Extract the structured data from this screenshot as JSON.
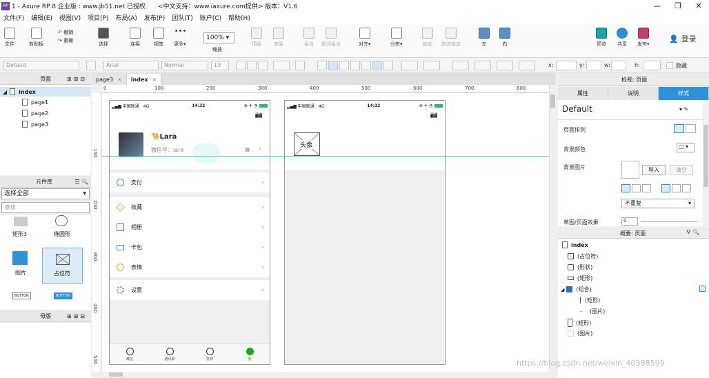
{
  "app": {
    "title": "1 - Axure RP 8 企业版 : www.jb51.net 已授权　　<中文支持：www.iaxure.com提供> 版本：V1.6",
    "logo_text": "RP"
  },
  "menu": [
    "文件(F)",
    "编辑(E)",
    "视图(V)",
    "项目(P)",
    "布局(A)",
    "发布(P)",
    "团队(T)",
    "账户(C)",
    "帮助(H)"
  ],
  "toolbar": {
    "file": "文件",
    "clipboard": "剪贴板",
    "cut_copy": "剪切",
    "undo": "撤销",
    "redo": "重做",
    "select": "选择",
    "connect": "连接",
    "pen": "钢笔",
    "more": "更多▾",
    "zoom_label": "缩放",
    "zoom_value": "100%",
    "top": "顶层",
    "bottom": "底层",
    "group": "组合",
    "ungroup": "取消组合",
    "align": "对齐▾",
    "distribute": "分布▾",
    "lock": "锁定",
    "unlock": "取消锁定",
    "left": "左",
    "right": "右",
    "preview": "预览",
    "share": "共享",
    "publish": "发布▾",
    "login": "登录"
  },
  "formatbar": {
    "style": "Default",
    "font": "Arial",
    "weight": "Normal",
    "size": "13",
    "x_label": "x:",
    "y_label": "y:",
    "w_label": "w:",
    "h_label": "h:",
    "hidden": "隐藏"
  },
  "pages_panel": {
    "title": "页面",
    "root": "index",
    "children": [
      "page1",
      "page2",
      "page3"
    ]
  },
  "library_panel": {
    "title": "元件库",
    "dropdown": "选择全部",
    "search_placeholder": "查找",
    "widgets": [
      {
        "label": "矩形3",
        "icon": "rectangle-icon"
      },
      {
        "label": "椭圆形",
        "icon": "ellipse-icon"
      },
      {
        "label": "图片",
        "icon": "image-icon"
      },
      {
        "label": "占位符",
        "icon": "placeholder-icon"
      },
      {
        "label": "BUTTON",
        "icon": "button-widget-icon"
      },
      {
        "label": "BUTTON",
        "icon": "primary-button-widget-icon"
      }
    ]
  },
  "masters_panel": {
    "title": "母版"
  },
  "editor": {
    "tabs": [
      {
        "label": "page3",
        "close": "×"
      },
      {
        "label": "index",
        "close": "×"
      }
    ],
    "h_ticks": [
      "0",
      "100",
      "200",
      "300",
      "400",
      "500",
      "600",
      "700",
      "800"
    ],
    "v_ticks": [
      "100",
      "200",
      "300",
      "400",
      "500"
    ]
  },
  "phone1": {
    "carrier": "▂▄▆ 中国联通　4G",
    "time": "14:32",
    "status_icons": "⊕ ✈ ◔",
    "username": "Lara",
    "wechat_id": "微信号：lara",
    "menu": [
      {
        "label": "支付",
        "icon": "wallet-check-icon",
        "color": "#3cb371"
      },
      {
        "label": "收藏",
        "icon": "cube-icon",
        "color": "#e8a23c"
      },
      {
        "label": "相册",
        "icon": "album-icon",
        "color": "#4a90d9"
      },
      {
        "label": "卡包",
        "icon": "card-icon",
        "color": "#4a90d9"
      },
      {
        "label": "表情",
        "icon": "smile-icon",
        "color": "#f0b400"
      },
      {
        "label": "设置",
        "icon": "settings-icon",
        "color": "#4a90d9"
      }
    ],
    "tabbar": [
      {
        "label": "微信"
      },
      {
        "label": "通讯录"
      },
      {
        "label": "发现"
      },
      {
        "label": "我"
      }
    ]
  },
  "phone2": {
    "carrier": "▂▄▆ 中国联通　4G",
    "time": "14:32",
    "avatar_placeholder": "头像"
  },
  "inspector": {
    "title": "检视: 页面",
    "tabs": [
      "属性",
      "说明",
      "样式"
    ],
    "style_name": "Default",
    "page_align": "页面排列",
    "bg_color": "背景颜色",
    "bg_image": "背景图片",
    "import": "导入",
    "clear": "清空",
    "repeat": "不重复",
    "sketch": "草图/页面效果",
    "sketch_value": "0"
  },
  "outline": {
    "title": "概要: 页面",
    "root": "index",
    "items": [
      {
        "label": "(占位符)",
        "icon": "placeholder-icon",
        "indent": 0
      },
      {
        "label": "(形状)",
        "icon": "camera-icon",
        "indent": 0
      },
      {
        "label": "(矩形)",
        "icon": "rectangle-icon",
        "indent": 0
      },
      {
        "label": "(组合)",
        "icon": "folder-icon",
        "indent": 0
      },
      {
        "label": "(矩形)",
        "icon": "line-icon",
        "indent": 1
      },
      {
        "label": "(图片)",
        "icon": "image-icon",
        "indent": 1
      },
      {
        "label": "(矩形)",
        "icon": "phone-frame-icon",
        "indent": 0
      },
      {
        "label": "(图片)",
        "icon": "image-icon",
        "indent": 0
      }
    ]
  },
  "watermark": "https://blog.csdn.net/weixin_40398599"
}
